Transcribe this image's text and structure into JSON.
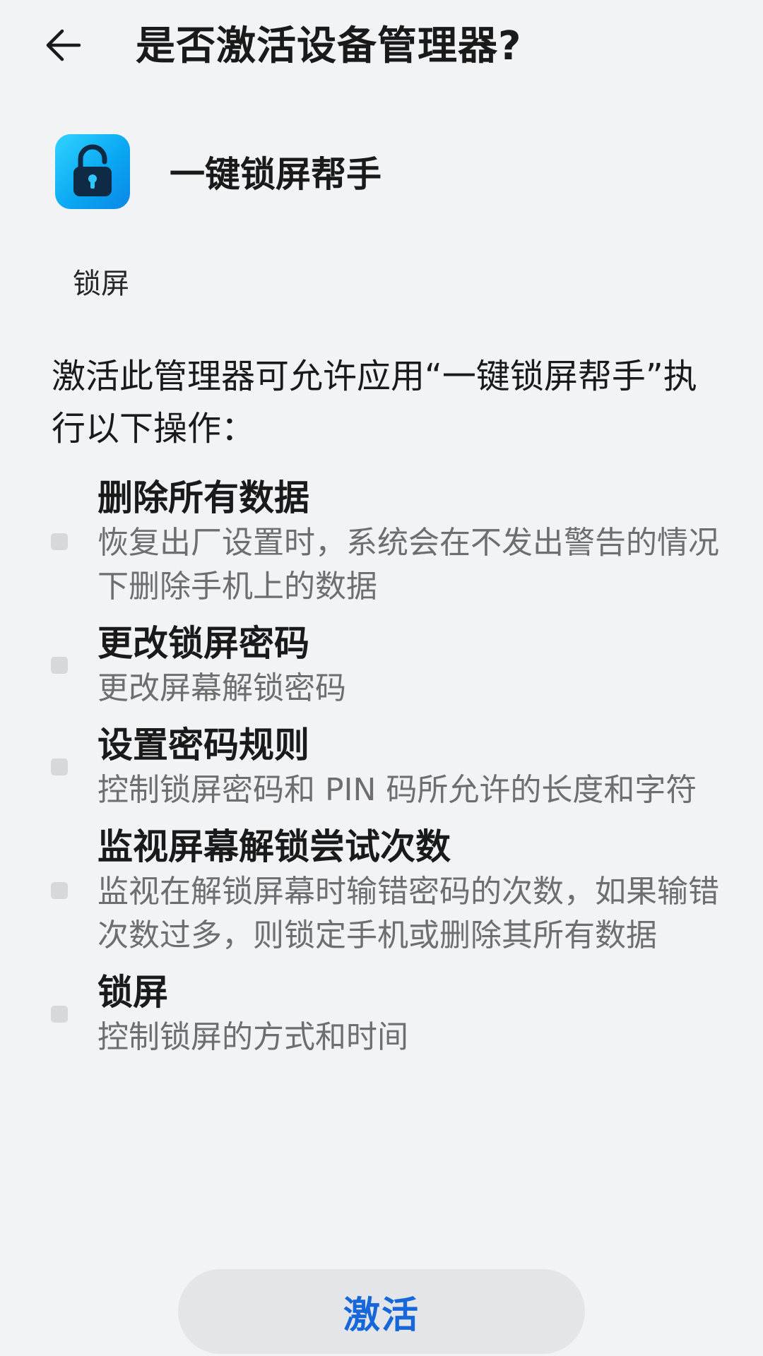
{
  "header": {
    "title": "是否激活设备管理器?",
    "back_icon": "arrow-left-icon"
  },
  "app": {
    "name": "一键锁屏帮手",
    "icon": "padlock-icon",
    "icon_color": "#0aa8f2"
  },
  "admin_label": "锁屏",
  "intro_text": "激活此管理器可允许应用“一键锁屏帮手”执行以下操作：",
  "permissions": [
    {
      "title": "删除所有数据",
      "description": "恢复出厂设置时，系统会在不发出警告的情况下删除手机上的数据"
    },
    {
      "title": "更改锁屏密码",
      "description": "更改屏幕解锁密码"
    },
    {
      "title": "设置密码规则",
      "description": "控制锁屏密码和 PIN 码所允许的长度和字符"
    },
    {
      "title": "监视屏幕解锁尝试次数",
      "description": "监视在解锁屏幕时输错密码的次数，如果输错次数过多，则锁定手机或删除其所有数据"
    },
    {
      "title": "锁屏",
      "description": "控制锁屏的方式和时间"
    }
  ],
  "activate_button": {
    "label": "激活",
    "color": "#1667d9"
  }
}
